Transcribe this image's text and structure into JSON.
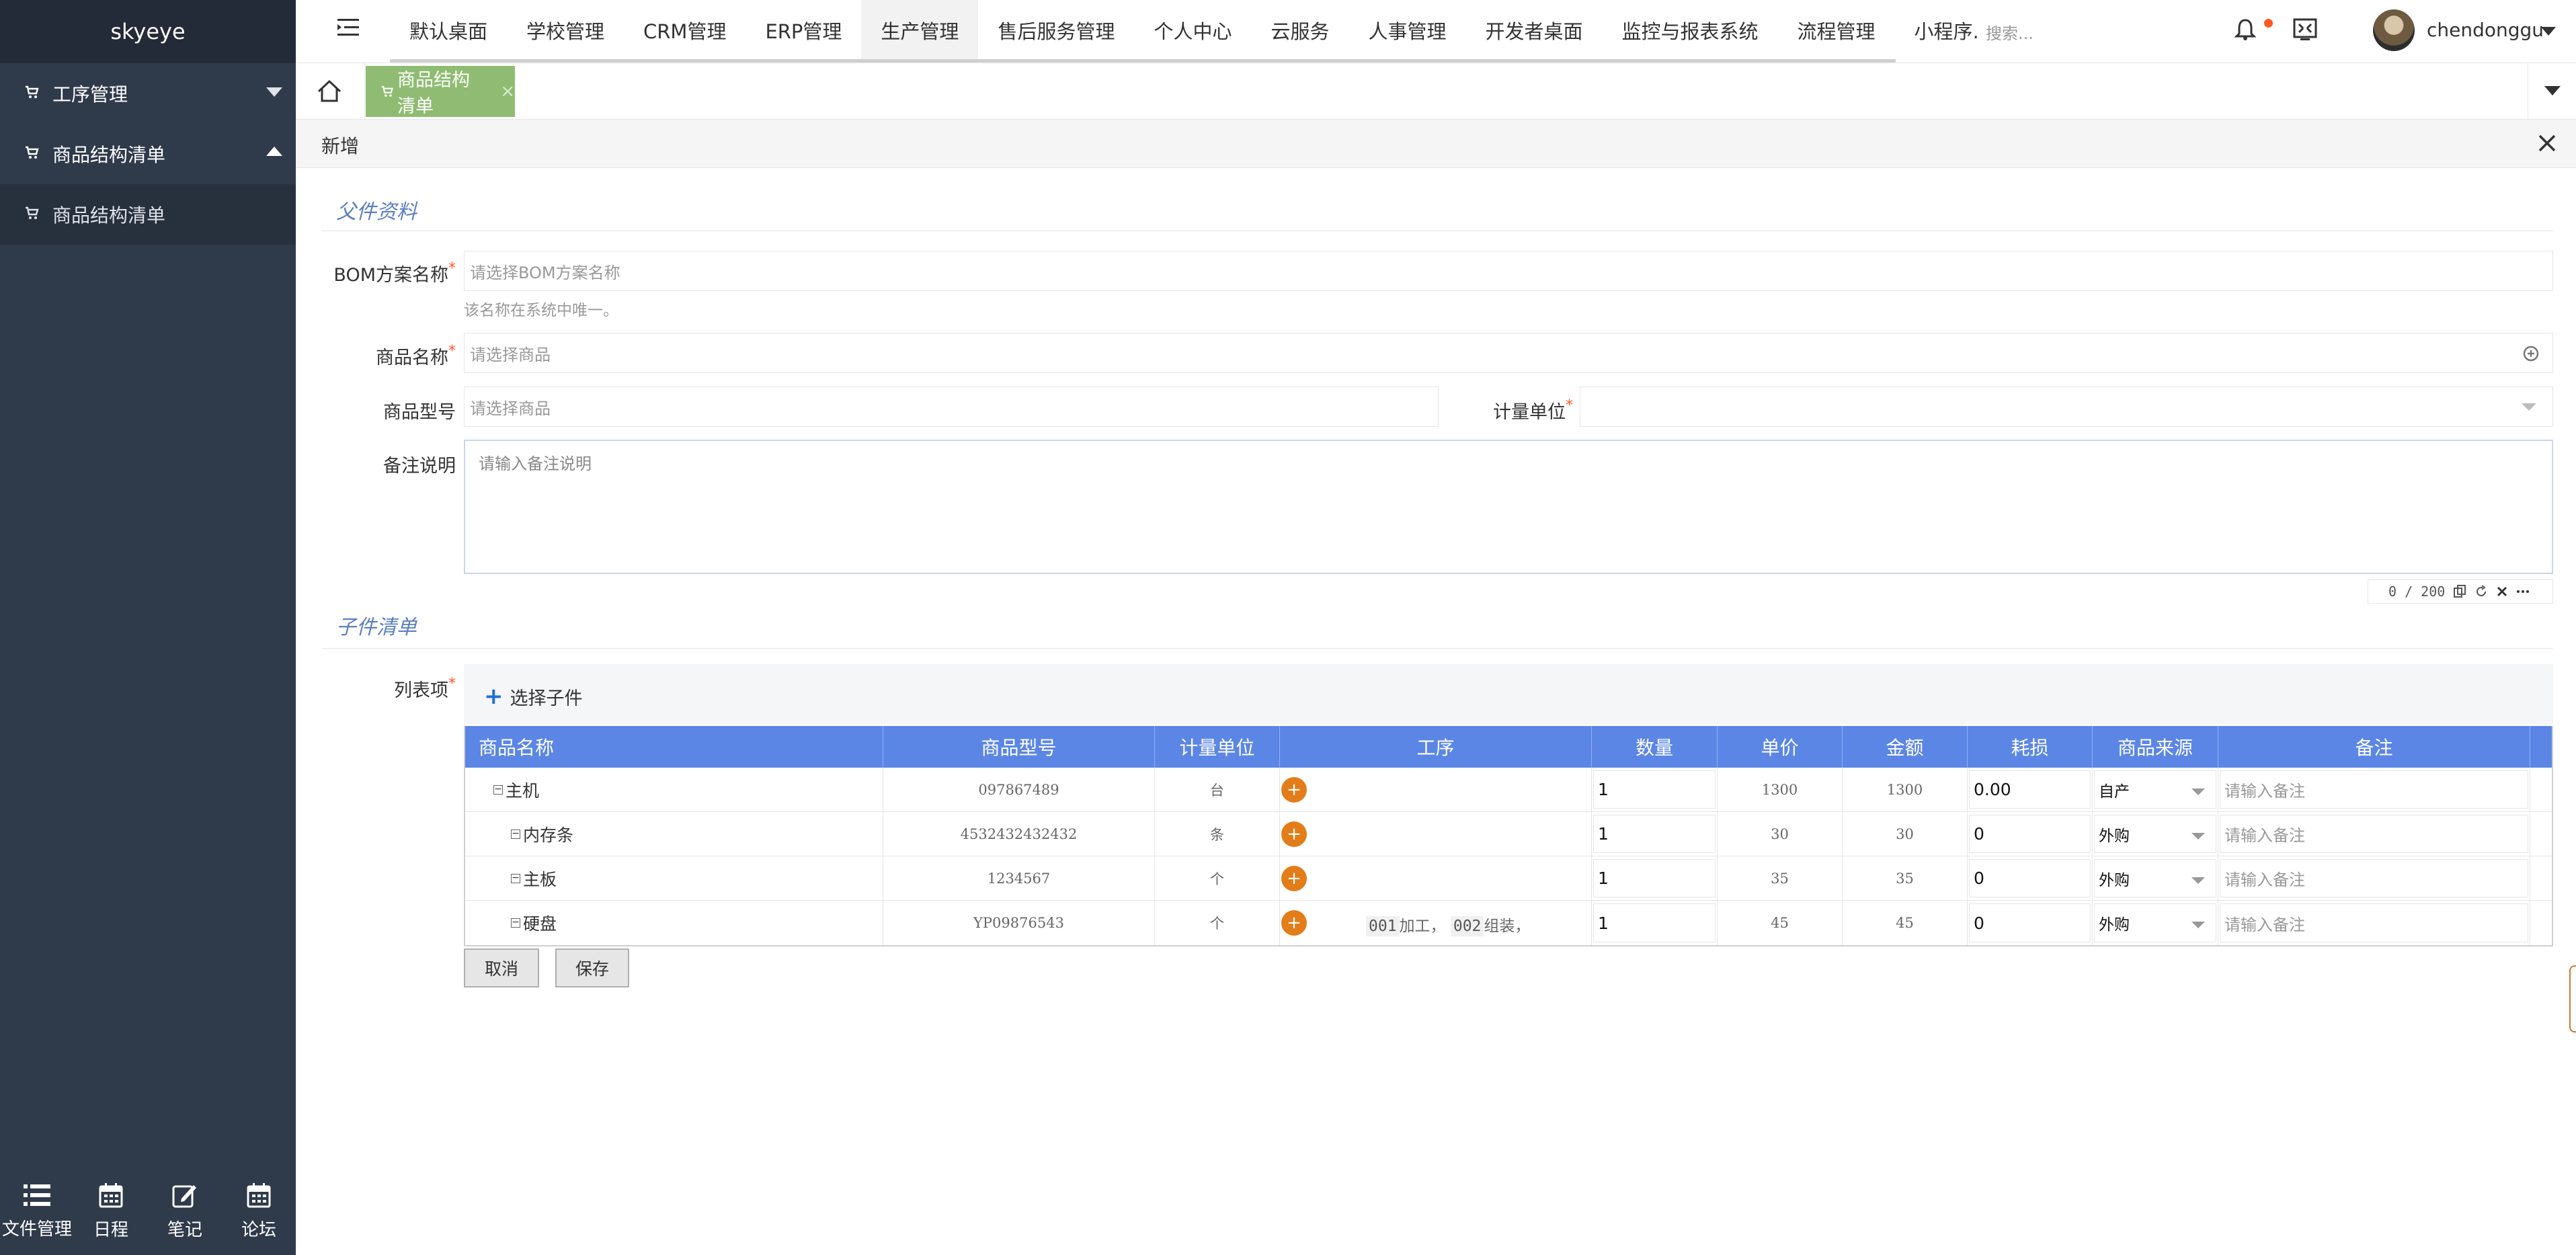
{
  "sidebar": {
    "brand": "skyeye",
    "items": [
      {
        "label": "工序管理",
        "type": "group",
        "expanded": false
      },
      {
        "label": "商品结构清单",
        "type": "group",
        "expanded": true
      },
      {
        "label": "商品结构清单",
        "type": "child"
      }
    ],
    "bottom": [
      {
        "label": "文件管理",
        "icon": "list-icon"
      },
      {
        "label": "日程",
        "icon": "calendar-icon"
      },
      {
        "label": "笔记",
        "icon": "edit-icon"
      },
      {
        "label": "论坛",
        "icon": "calendar-icon"
      }
    ]
  },
  "topnav": {
    "items": [
      "默认桌面",
      "学校管理",
      "CRM管理",
      "ERP管理",
      "生产管理",
      "售后服务管理",
      "个人中心",
      "云服务",
      "人事管理",
      "开发者桌面",
      "监控与报表系统",
      "流程管理",
      "小程序."
    ],
    "active": "生产管理",
    "search_placeholder": "搜索...",
    "username": "chendonggu"
  },
  "tabs": {
    "active_tab": "商品结构清单",
    "close": "×"
  },
  "panel": {
    "title": "新增"
  },
  "form": {
    "section_parent": "父件资料",
    "bom_label": "BOM方案名称",
    "bom_placeholder": "请选择BOM方案名称",
    "bom_hint": "该名称在系统中唯一。",
    "product_label": "商品名称",
    "product_placeholder": "请选择商品",
    "model_label": "商品型号",
    "model_placeholder": "请选择商品",
    "unit_label": "计量单位",
    "unit_value": "",
    "remark_label": "备注说明",
    "remark_placeholder": "请输入备注说明",
    "counter": "0 / 200",
    "section_child": "子件清单",
    "list_label": "列表项",
    "choose_child": "选择子件"
  },
  "table": {
    "headers": [
      "商品名称",
      "商品型号",
      "计量单位",
      "工序",
      "数量",
      "单价",
      "金额",
      "耗损",
      "商品来源",
      "备注"
    ],
    "remark_placeholder": "请输入备注",
    "rows": [
      {
        "name": "主机",
        "model": "097867489",
        "unit": "台",
        "process": "",
        "qty": "1",
        "price": "1300",
        "amount": "1300",
        "loss": "0.00",
        "source": "自产"
      },
      {
        "name": "内存条",
        "model": "4532432432432",
        "unit": "条",
        "process": "",
        "qty": "1",
        "price": "30",
        "amount": "30",
        "loss": "0",
        "source": "外购"
      },
      {
        "name": "主板",
        "model": "1234567",
        "unit": "个",
        "process": "",
        "qty": "1",
        "price": "35",
        "amount": "35",
        "loss": "0",
        "source": "外购"
      },
      {
        "name": "硬盘",
        "model": "YP09876543",
        "unit": "个",
        "process_code1": "001",
        "process_text1": "加工，",
        "process_code2": "002",
        "process_text2": "组装，",
        "qty": "1",
        "price": "45",
        "amount": "45",
        "loss": "0",
        "source": "外购"
      }
    ]
  },
  "actions": {
    "cancel": "取消",
    "save": "保存"
  },
  "colors": {
    "sidebar": "#2f3a4b",
    "tab_active": "#8fbc72",
    "table_header": "#5b86e5",
    "add_button": "#e27d1a",
    "section_title": "#5b7fbf"
  }
}
